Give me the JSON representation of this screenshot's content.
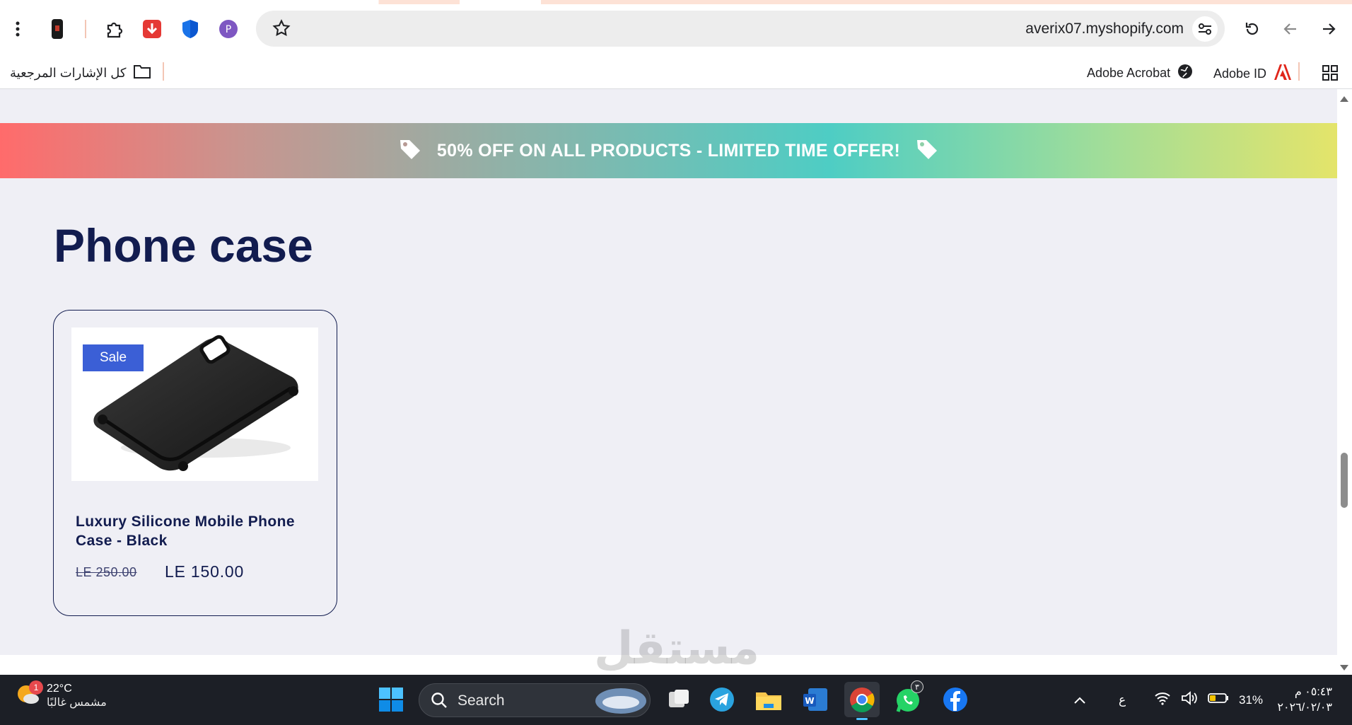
{
  "browser": {
    "url": "averix07.myshopify.com",
    "bookmarks": {
      "all_bookmarks": "كل الإشارات المرجعية",
      "adobe_acrobat": "Adobe Acrobat",
      "adobe_id": "Adobe ID"
    }
  },
  "page": {
    "promo_banner": "50% OFF ON ALL PRODUCTS - LIMITED TIME OFFER!",
    "collection_title": "Phone case",
    "product": {
      "badge": "Sale",
      "title": "Luxury Silicone Mobile Phone Case - Black",
      "compare_price": "LE 250.00",
      "price": "LE 150.00"
    }
  },
  "taskbar": {
    "weather_temp": "22°C",
    "weather_desc": "مشمس غالبًا",
    "weather_badge": "1",
    "search_label": "Search",
    "whatsapp_badge": "٣",
    "lang": "ع",
    "battery": "31%",
    "time": "٠٥:٤٣ م",
    "date": "٢٠٢٦/٠٢/٠٣"
  },
  "watermark": "مستقل",
  "colors": {
    "brand_navy": "#121c4f",
    "sale_blue": "#3b5fd6",
    "page_bg": "#efeff5"
  }
}
